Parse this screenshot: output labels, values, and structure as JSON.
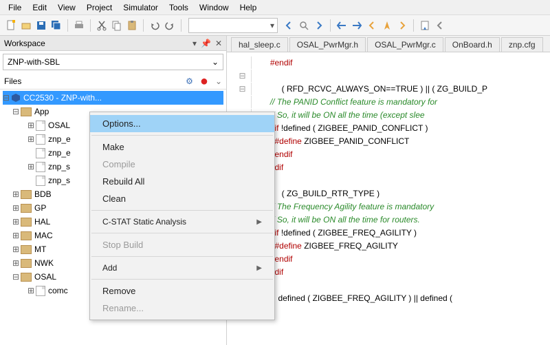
{
  "menu": {
    "items": [
      "File",
      "Edit",
      "View",
      "Project",
      "Simulator",
      "Tools",
      "Window",
      "Help"
    ]
  },
  "workspace": {
    "title": "Workspace",
    "dropdown": "ZNP-with-SBL",
    "files_label": "Files",
    "root": "CC2530 - ZNP-with...",
    "folders": {
      "app": "App",
      "app_children": [
        "OSAL",
        "znp_e",
        "znp_e",
        "znp_s",
        "znp_s"
      ],
      "others": [
        "BDB",
        "GP",
        "HAL",
        "MAC",
        "MT",
        "NWK",
        "OSAL"
      ],
      "osal_child": "comc"
    }
  },
  "tabs": [
    "hal_sleep.c",
    "OSAL_PwrMgr.h",
    "OSAL_PwrMgr.c",
    "OnBoard.h",
    "znp.cfg"
  ],
  "code": {
    "l1": "#endif",
    "l2a": "( RFD_RCVC_ALWAYS_ON==TRUE ) || ( ZG_BUILD_P",
    "l3": "// The PANID Conflict feature is mandatory for",
    "l4": "// So, it will be ON all the time (except slee",
    "l5a": "#if",
    "l5b": " !defined ( ZIGBEE_PANID_CONFLICT )",
    "l6a": "  #define",
    "l6b": " ZIGBEE_PANID_CONFLICT",
    "l7": "#endif",
    "l8": "ndif",
    "l9": "( ZG_BUILD_RTR_TYPE )",
    "l10": "// The Frequency Agility feature is mandatory ",
    "l11": "// So, it will be ON all the time for routers.",
    "l12a": "#if",
    "l12b": " !defined ( ZIGBEE_FREQ_AGILITY )",
    "l13a": "  #define",
    "l13b": " ZIGBEE_FREQ_AGILITY",
    "l14": "#endif",
    "l15": "ndif",
    "l16": " defined ( ZIGBEE_FREQ_AGILITY ) || defined ("
  },
  "context_menu": {
    "options": "Options...",
    "make": "Make",
    "compile": "Compile",
    "rebuild": "Rebuild All",
    "clean": "Clean",
    "cstat": "C-STAT Static Analysis",
    "stop": "Stop Build",
    "add": "Add",
    "remove": "Remove",
    "rename": "Rename..."
  }
}
